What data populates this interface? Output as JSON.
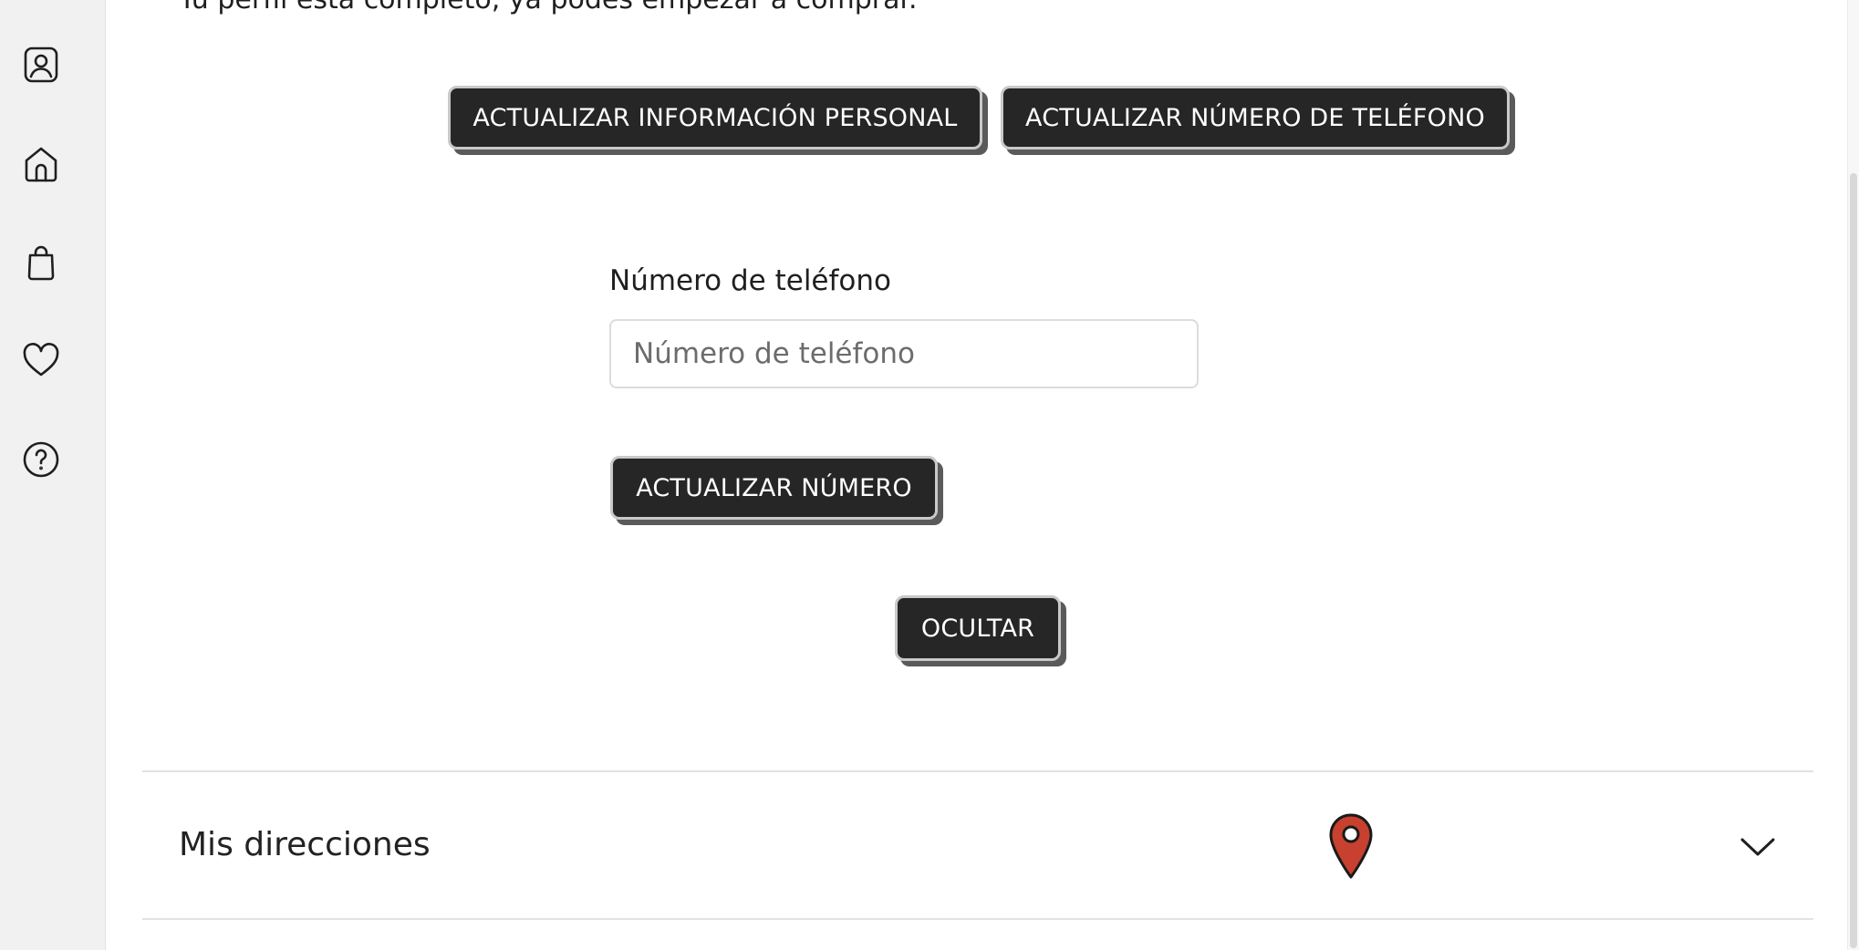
{
  "profile": {
    "status_text": "Tu perfil está completo, ya podés empezar a comprar."
  },
  "actions": {
    "update_personal_label": "ACTUALIZAR INFORMACIÓN PERSONAL",
    "update_phone_label": "ACTUALIZAR NÚMERO DE TELÉFONO"
  },
  "phone_form": {
    "label": "Número de teléfono",
    "placeholder": "Número de teléfono",
    "value": "",
    "submit_label": "ACTUALIZAR NÚMERO",
    "hide_label": "OCULTAR"
  },
  "addresses": {
    "title": "Mis direcciones",
    "pin_color": "#c8402f"
  },
  "sidebar": {
    "items": [
      {
        "icon": "user-profile-icon"
      },
      {
        "icon": "home-icon"
      },
      {
        "icon": "shopping-bag-icon"
      },
      {
        "icon": "heart-icon"
      },
      {
        "icon": "help-icon"
      }
    ]
  },
  "colors": {
    "button_bg": "#262626",
    "button_text": "#ffffff",
    "sidebar_bg": "#f1f1f1"
  }
}
